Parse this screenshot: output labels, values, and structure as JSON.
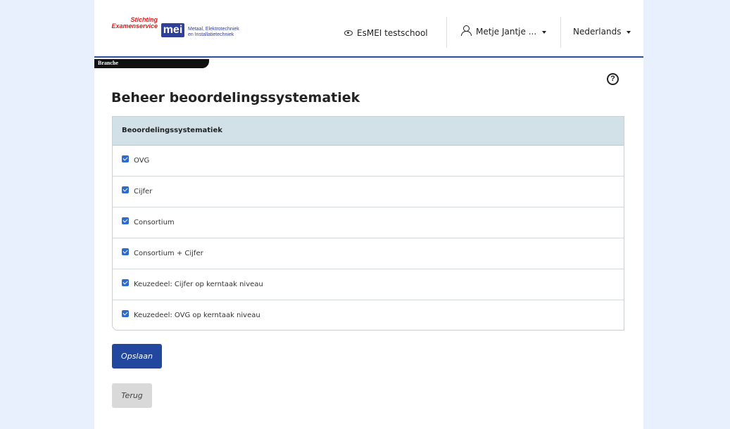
{
  "header": {
    "logo": {
      "line1": "Stichting",
      "line2": "Examenservice",
      "mark": "mei",
      "sub1": "Metaal, Elektrotechniek",
      "sub2": "en Installatietechniek"
    },
    "school": "EsMEI testschool",
    "user": "Metje Jantje ...",
    "language": "Nederlands"
  },
  "breadcrumb": "Branche",
  "page_title": "Beheer beoordelingssystematiek",
  "table": {
    "header": "Beoordelingssystematiek",
    "rows": [
      {
        "label": "OVG",
        "checked": true
      },
      {
        "label": "Cijfer",
        "checked": true
      },
      {
        "label": "Consortium",
        "checked": true
      },
      {
        "label": "Consortium + Cijfer",
        "checked": true
      },
      {
        "label": "Keuzedeel: Cijfer op kerntaak niveau",
        "checked": true
      },
      {
        "label": "Keuzedeel: OVG op kerntaak niveau",
        "checked": true
      }
    ]
  },
  "buttons": {
    "save": "Opslaan",
    "back": "Terug"
  },
  "icons": {
    "help": "?"
  },
  "colors": {
    "accent": "#22479e",
    "table_header_bg": "#d2e0e7",
    "checkbox": "#2d6bd0",
    "background": "#e8effd"
  }
}
